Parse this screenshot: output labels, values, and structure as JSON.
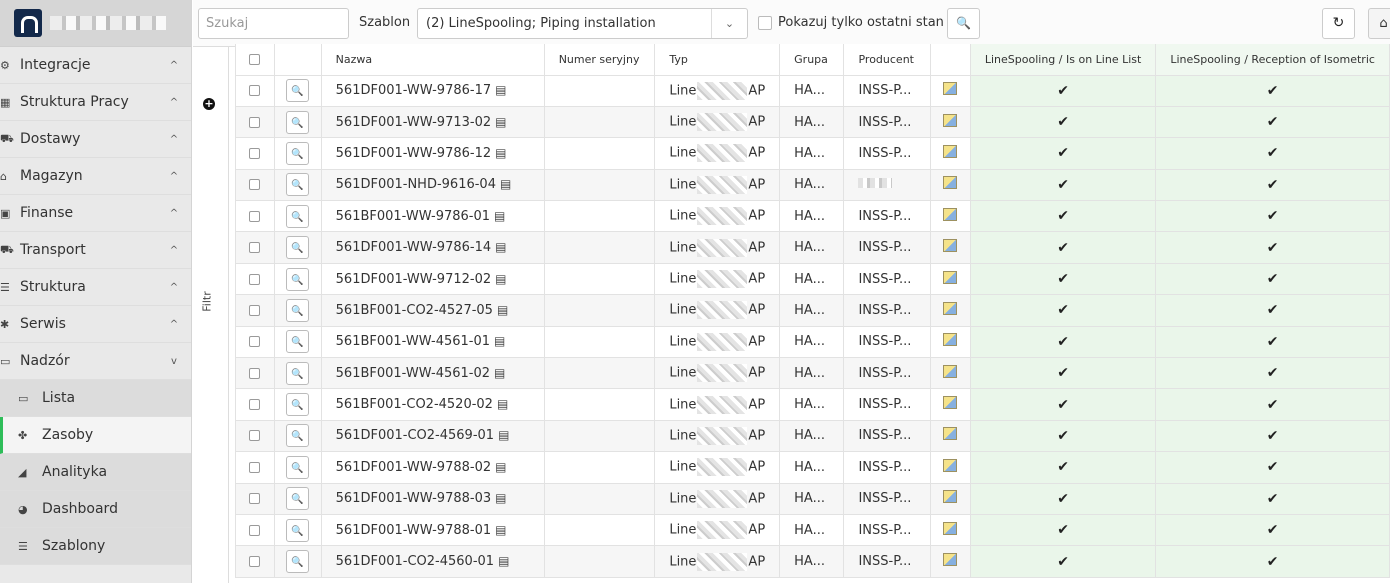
{
  "sidebar": {
    "logo_icon": "company-logo-icon",
    "items": [
      {
        "label": "Integracje",
        "icon": "integration-icon",
        "glyph": "⚙",
        "chevron": "^"
      },
      {
        "label": "Struktura Pracy",
        "icon": "sitemap-icon",
        "glyph": "▦",
        "chevron": "^"
      },
      {
        "label": "Dostawy",
        "icon": "truck-icon",
        "glyph": "⛟",
        "chevron": "^"
      },
      {
        "label": "Magazyn",
        "icon": "warehouse-icon",
        "glyph": "⌂",
        "chevron": "^"
      },
      {
        "label": "Finanse",
        "icon": "money-icon",
        "glyph": "▣",
        "chevron": "^"
      },
      {
        "label": "Transport",
        "icon": "truck-icon",
        "glyph": "⛟",
        "chevron": "^"
      },
      {
        "label": "Struktura",
        "icon": "list-icon",
        "glyph": "☰",
        "chevron": "^"
      },
      {
        "label": "Serwis",
        "icon": "bug-icon",
        "glyph": "✱",
        "chevron": "^"
      },
      {
        "label": "Nadzór",
        "icon": "ruler-icon",
        "glyph": "▭",
        "chevron": "v"
      }
    ],
    "subitems": [
      {
        "label": "Lista",
        "icon": "ruler-icon",
        "glyph": "▭"
      },
      {
        "label": "Zasoby",
        "icon": "cubes-icon",
        "glyph": "✤"
      },
      {
        "label": "Analityka",
        "icon": "chart-icon",
        "glyph": "◢"
      },
      {
        "label": "Dashboard",
        "icon": "gauge-icon",
        "glyph": "◕"
      },
      {
        "label": "Szablony",
        "icon": "list-icon",
        "glyph": "☰"
      }
    ]
  },
  "filter": {
    "tab_label": "Filtr",
    "add_glyph": "+"
  },
  "toolbar": {
    "search_placeholder": "Szukaj",
    "template_label": "Szablon",
    "template_value": "(2) LineSpooling; Piping installation",
    "dropdown_glyph": "⌄",
    "last_state_label": "Pokazuj tylko ostatni stan",
    "search_button_glyph": "🔍",
    "refresh_glyph": "↻",
    "home_glyph": "⌂"
  },
  "table": {
    "columns": [
      "Nazwa",
      "Numer seryjny",
      "Typ",
      "Grupa",
      "Producent",
      "LineSpooling / Is on Line List",
      "LineSpooling / Reception of Isometric"
    ],
    "rows": [
      {
        "name": "561DF001-WW-9786-17",
        "serial": "",
        "type_prefix": "Line",
        "type_suffix": "AP",
        "group": "HA...",
        "producer": "INSS-P..."
      },
      {
        "name": "561DF001-WW-9713-02",
        "serial": "",
        "type_prefix": "Line",
        "type_suffix": "AP",
        "group": "HA...",
        "producer": "INSS-P..."
      },
      {
        "name": "561DF001-WW-9786-12",
        "serial": "",
        "type_prefix": "Line",
        "type_suffix": "AP",
        "group": "HA...",
        "producer": "INSS-P..."
      },
      {
        "name": "561DF001-NHD-9616-04",
        "serial": "",
        "type_prefix": "Line",
        "type_suffix": "AP",
        "group": "HA...",
        "producer": ""
      },
      {
        "name": "561BF001-WW-9786-01",
        "serial": "",
        "type_prefix": "Line",
        "type_suffix": "AP",
        "group": "HA...",
        "producer": "INSS-P..."
      },
      {
        "name": "561DF001-WW-9786-14",
        "serial": "",
        "type_prefix": "Line",
        "type_suffix": "AP",
        "group": "HA...",
        "producer": "INSS-P..."
      },
      {
        "name": "561DF001-WW-9712-02",
        "serial": "",
        "type_prefix": "Line",
        "type_suffix": "AP",
        "group": "HA...",
        "producer": "INSS-P..."
      },
      {
        "name": "561BF001-CO2-4527-05",
        "serial": "",
        "type_prefix": "Line",
        "type_suffix": "AP",
        "group": "HA...",
        "producer": "INSS-P..."
      },
      {
        "name": "561BF001-WW-4561-01",
        "serial": "",
        "type_prefix": "Line",
        "type_suffix": "AP",
        "group": "HA...",
        "producer": "INSS-P..."
      },
      {
        "name": "561BF001-WW-4561-02",
        "serial": "",
        "type_prefix": "Line",
        "type_suffix": "AP",
        "group": "HA...",
        "producer": "INSS-P..."
      },
      {
        "name": "561BF001-CO2-4520-02",
        "serial": "",
        "type_prefix": "Line",
        "type_suffix": "AP",
        "group": "HA...",
        "producer": "INSS-P..."
      },
      {
        "name": "561DF001-CO2-4569-01",
        "serial": "",
        "type_prefix": "Line",
        "type_suffix": "AP",
        "group": "HA...",
        "producer": "INSS-P..."
      },
      {
        "name": "561DF001-WW-9788-02",
        "serial": "",
        "type_prefix": "Line",
        "type_suffix": "AP",
        "group": "HA...",
        "producer": "INSS-P..."
      },
      {
        "name": "561DF001-WW-9788-03",
        "serial": "",
        "type_prefix": "Line",
        "type_suffix": "AP",
        "group": "HA...",
        "producer": "INSS-P..."
      },
      {
        "name": "561DF001-WW-9788-01",
        "serial": "",
        "type_prefix": "Line",
        "type_suffix": "AP",
        "group": "HA...",
        "producer": "INSS-P..."
      },
      {
        "name": "561DF001-CO2-4560-01",
        "serial": "",
        "type_prefix": "Line",
        "type_suffix": "AP",
        "group": "HA...",
        "producer": "INSS-P..."
      }
    ],
    "check_glyph": "✔",
    "clipboard_glyph": "▤",
    "search_glyph": "🔍"
  },
  "colors": {
    "accent": "#2ebd59",
    "logo": "#13294b",
    "check_cell_bg": "#eaf6ea"
  }
}
